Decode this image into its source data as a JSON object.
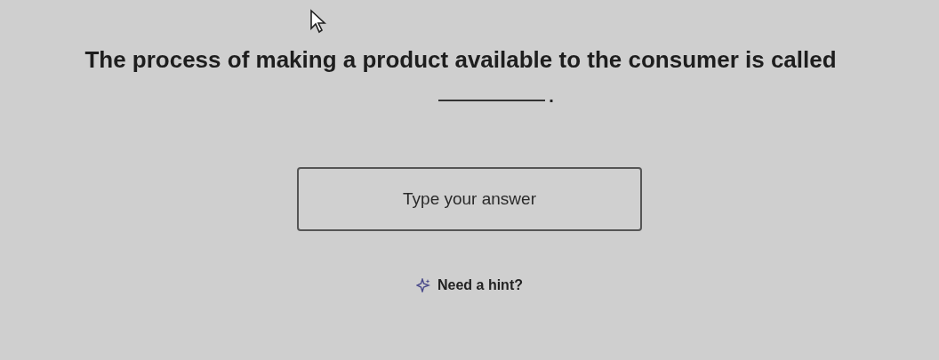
{
  "question": {
    "text": "The process of making a product available to the consumer is called",
    "blank_end": "."
  },
  "answer": {
    "placeholder": "Type your answer"
  },
  "hint": {
    "label": "Need a hint?"
  }
}
